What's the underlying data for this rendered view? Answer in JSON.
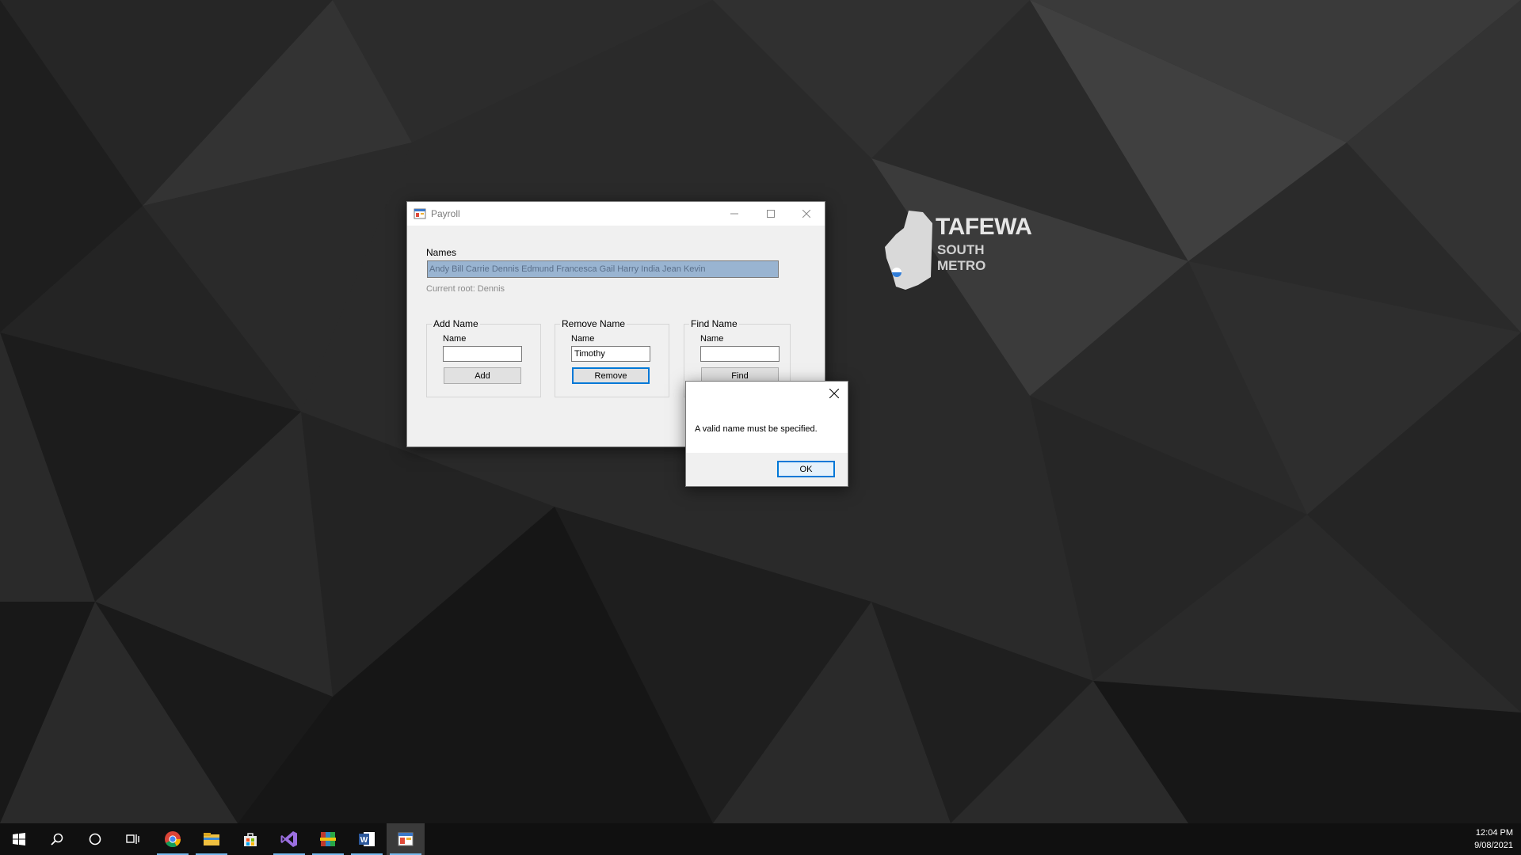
{
  "desktop": {
    "logo": {
      "brand_main": "TAFEWA",
      "brand_line1": "SOUTH",
      "brand_line2": "METRO"
    }
  },
  "window": {
    "title": "Payroll",
    "icon": "form-app-icon",
    "names_label": "Names",
    "names_value": "Andy Bill Carrie Dennis Edmund Francesca Gail Harry India Jean Kevin",
    "current_root": "Current root: Dennis",
    "groups": {
      "add": {
        "title": "Add Name",
        "field_label": "Name",
        "field_value": "",
        "button": "Add"
      },
      "remove": {
        "title": "Remove Name",
        "field_label": "Name",
        "field_value": "Timothy",
        "button": "Remove"
      },
      "find": {
        "title": "Find Name",
        "field_label": "Name",
        "field_value": "",
        "button": "Find"
      }
    }
  },
  "message_box": {
    "text": "A valid name must be specified.",
    "ok_label": "OK"
  },
  "taskbar": {
    "items": [
      "start-icon",
      "search-icon",
      "cortana-icon",
      "task-view-icon",
      "chrome-icon",
      "file-explorer-icon",
      "store-icon",
      "visual-studio-icon",
      "winrar-icon",
      "word-icon",
      "payroll-app-icon"
    ],
    "time": "12:04 PM",
    "date": "9/08/2021",
    "accent": "#76b9ed"
  }
}
